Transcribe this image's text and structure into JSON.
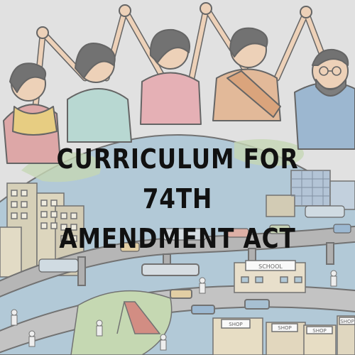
{
  "title": {
    "line1": "CURRICULUM FOR 74TH",
    "line2": "AMENDMENT ACT"
  },
  "signs": {
    "school": "SCHOOL",
    "shop1": "SHOP",
    "shop2": "SHOP",
    "shop3": "SHOP",
    "shop4": "SHOP"
  },
  "colors": {
    "globe_blue": "#8fb3c9",
    "road": "#9c9c9c",
    "sari_orange": "#e0a77a",
    "scarf_yellow": "#e7c25a",
    "kurta_pink": "#e39aa1",
    "shirt_blue": "#7ea4c7",
    "park_green": "#a8c98a",
    "slide_red": "#c96a5c"
  }
}
